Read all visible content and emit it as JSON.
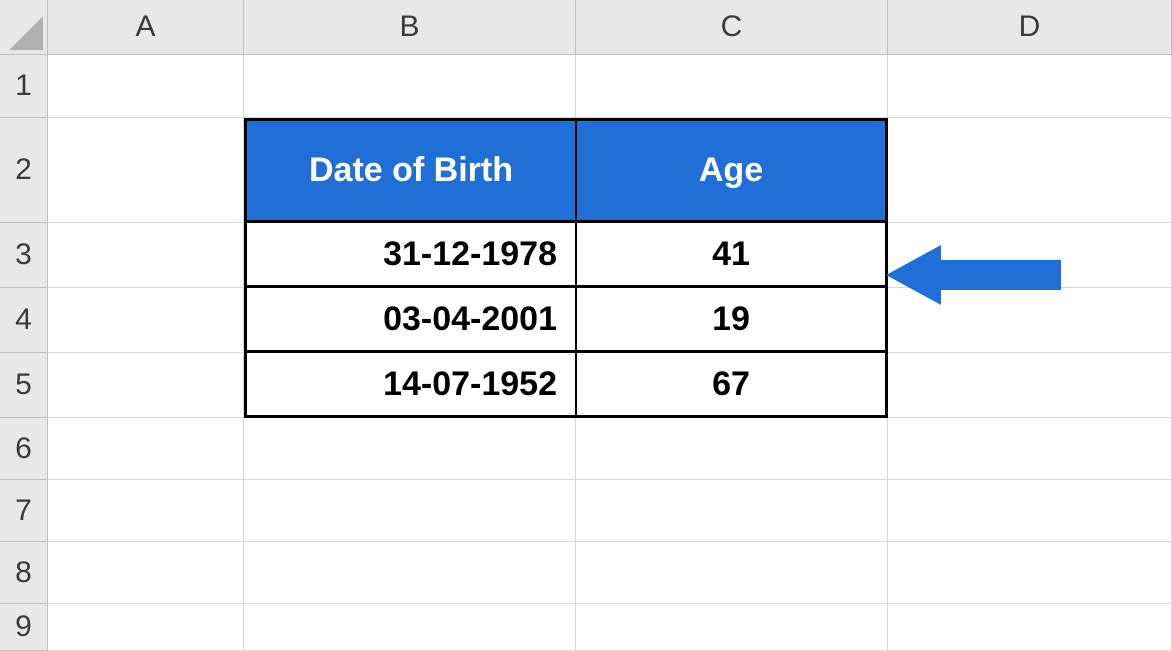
{
  "columns": {
    "A": "A",
    "B": "B",
    "C": "C",
    "D": "D"
  },
  "rows": {
    "1": "1",
    "2": "2",
    "3": "3",
    "4": "4",
    "5": "5",
    "6": "6",
    "7": "7",
    "8": "8",
    "9": "9"
  },
  "table": {
    "header": {
      "dob": "Date of Birth",
      "age": "Age"
    },
    "data": [
      {
        "dob": "31-12-1978",
        "age": "41"
      },
      {
        "dob": "03-04-2001",
        "age": "19"
      },
      {
        "dob": "14-07-1952",
        "age": "67"
      }
    ]
  },
  "chart_data": {
    "type": "table",
    "title": "",
    "columns": [
      "Date of Birth",
      "Age"
    ],
    "rows": [
      [
        "31-12-1978",
        41
      ],
      [
        "03-04-2001",
        19
      ],
      [
        "14-07-1952",
        67
      ]
    ]
  },
  "arrow": {
    "target_row": 3
  }
}
